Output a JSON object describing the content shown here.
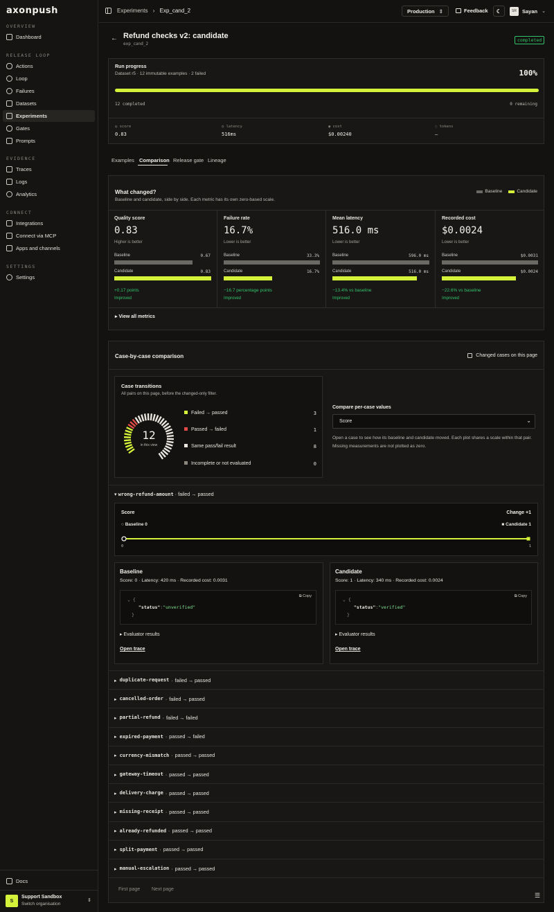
{
  "brand": "axonpush",
  "sidebar": {
    "sections": [
      {
        "title": "OVERVIEW",
        "items": [
          {
            "label": "Dashboard",
            "icon": "grid-icon"
          }
        ]
      },
      {
        "title": "RELEASE LOOP",
        "items": [
          {
            "label": "Actions",
            "icon": "shield-icon"
          },
          {
            "label": "Loop",
            "icon": "refresh-icon"
          },
          {
            "label": "Failures",
            "icon": "alert-icon"
          },
          {
            "label": "Datasets",
            "icon": "table-icon"
          },
          {
            "label": "Experiments",
            "icon": "flask-icon",
            "active": true
          },
          {
            "label": "Gates",
            "icon": "shield-check-icon"
          },
          {
            "label": "Prompts",
            "icon": "prompt-icon"
          }
        ]
      },
      {
        "title": "EVIDENCE",
        "items": [
          {
            "label": "Traces",
            "icon": "trace-icon"
          },
          {
            "label": "Logs",
            "icon": "log-icon"
          },
          {
            "label": "Analytics",
            "icon": "chart-icon"
          }
        ]
      },
      {
        "title": "CONNECT",
        "items": [
          {
            "label": "Integrations",
            "icon": "plug-icon"
          },
          {
            "label": "Connect via MCP",
            "icon": "link-icon"
          },
          {
            "label": "Apps and channels",
            "icon": "apps-icon"
          }
        ]
      },
      {
        "title": "SETTINGS",
        "items": [
          {
            "label": "Settings",
            "icon": "gear-icon"
          }
        ]
      }
    ],
    "docs": "Docs",
    "org": {
      "avatar": "S",
      "name": "Support Sandbox",
      "sub": "Switch organisation"
    }
  },
  "header": {
    "breadcrumb": [
      "Experiments",
      "Exp_cand_2"
    ],
    "env": "Production",
    "feedback": "Feedback",
    "user": {
      "initials": "SR",
      "name": "Sayan"
    }
  },
  "page": {
    "title": "Refund checks v2: candidate",
    "id": "exp_cand_2",
    "status": "completed"
  },
  "progress": {
    "title": "Run progress",
    "subtitle": "Dataset r5 · 12 immutable examples · 2 failed",
    "percent": "100%",
    "fraction": 1.0,
    "completed": "12 completed",
    "remaining": "0 remaining",
    "stats": [
      {
        "label": "score",
        "value": "0.83"
      },
      {
        "label": "latency",
        "value": "516ms"
      },
      {
        "label": "cost",
        "value": "$0.00240"
      },
      {
        "label": "tokens",
        "value": "—"
      }
    ]
  },
  "tabs": [
    "Examples",
    "Comparison",
    "Release gate",
    "Lineage"
  ],
  "active_tab": "Comparison",
  "changed": {
    "title": "What changed?",
    "subtitle": "Baseline and candidate, side by side. Each metric has its own zero-based scale.",
    "legend": {
      "baseline": "Baseline",
      "candidate": "Candidate"
    },
    "metrics": [
      {
        "title": "Quality score",
        "value": "0.83",
        "hint": "Higher is better",
        "baseline_label": "Baseline",
        "baseline": "0.67",
        "baseline_frac": 0.81,
        "candidate_label": "Candidate",
        "candidate": "0.83",
        "candidate_frac": 1.0,
        "delta": "+0.17 points",
        "verdict": "Improved"
      },
      {
        "title": "Failure rate",
        "value": "16.7%",
        "hint": "Lower is better",
        "baseline_label": "Baseline",
        "baseline": "33.3%",
        "baseline_frac": 1.0,
        "candidate_label": "Candidate",
        "candidate": "16.7%",
        "candidate_frac": 0.5,
        "delta": "−16.7 percentage points",
        "verdict": "Improved"
      },
      {
        "title": "Mean latency",
        "value": "516.0 ms",
        "hint": "Lower is better",
        "baseline_label": "Baseline",
        "baseline": "596.0 ms",
        "baseline_frac": 1.0,
        "candidate_label": "Candidate",
        "candidate": "516.0 ms",
        "candidate_frac": 0.87,
        "delta": "−13.4% vs baseline",
        "verdict": "Improved"
      },
      {
        "title": "Recorded cost",
        "value": "$0.0024",
        "hint": "Lower is better",
        "baseline_label": "Baseline",
        "baseline": "$0.0031",
        "baseline_frac": 1.0,
        "candidate_label": "Candidate",
        "candidate": "$0.0024",
        "candidate_frac": 0.77,
        "delta": "−22.6% vs baseline",
        "verdict": "Improved"
      }
    ],
    "view_all": "View all metrics"
  },
  "cases": {
    "title": "Case-by-case comparison",
    "filter_label": "Changed cases on this page",
    "transitions": {
      "title": "Case transitions",
      "subtitle": "All pairs on this page, before the changed-only filter.",
      "total": "12",
      "total_sub": "in this view",
      "rows": [
        {
          "label": "Failed → passed",
          "count": "3",
          "color": "#d4f23a"
        },
        {
          "label": "Passed → failed",
          "count": "1",
          "color": "#e04b45"
        },
        {
          "label": "Same pass/fail result",
          "count": "8",
          "color": "#e8e6df"
        },
        {
          "label": "Incomplete or not evaluated",
          "count": "0",
          "color": "#8a877f"
        }
      ]
    },
    "compare": {
      "label": "Compare per-case values",
      "selected": "Score",
      "help": "Open a case to see how its baseline and candidate moved. Each plot shares a scale within that pair. Missing measurements are not plotted as zero."
    },
    "expanded": {
      "name": "wrong-refund-amount",
      "transition": "failed → passed",
      "plot": {
        "title": "Score",
        "change": "Change +1",
        "baseline_label": "Baseline 0",
        "candidate_label": "Candidate 1",
        "min": "0",
        "max": "1",
        "baseline_value": 0,
        "candidate_value": 1
      },
      "baseline": {
        "title": "Baseline",
        "meta": "Score: 0 · Latency: 420 ms · Recorded cost: 0.0031",
        "copy": "Copy",
        "key": "\"status\"",
        "value": "\"unverified\"",
        "evaluator": "Evaluator results",
        "trace": "Open trace"
      },
      "candidate": {
        "title": "Candidate",
        "meta": "Score: 1 · Latency: 340 ms · Recorded cost: 0.0024",
        "copy": "Copy",
        "key": "\"status\"",
        "value": "\"verified\"",
        "evaluator": "Evaluator results",
        "trace": "Open trace"
      }
    },
    "rows": [
      {
        "name": "duplicate-request",
        "transition": "failed → passed"
      },
      {
        "name": "cancelled-order",
        "transition": "failed → passed"
      },
      {
        "name": "partial-refund",
        "transition": "failed → failed"
      },
      {
        "name": "expired-payment",
        "transition": "passed → failed"
      },
      {
        "name": "currency-mismatch",
        "transition": "passed → passed"
      },
      {
        "name": "gateway-timeout",
        "transition": "passed → passed"
      },
      {
        "name": "delivery-charge",
        "transition": "passed → passed"
      },
      {
        "name": "missing-receipt",
        "transition": "passed → passed"
      },
      {
        "name": "already-refunded",
        "transition": "passed → passed"
      },
      {
        "name": "split-payment",
        "transition": "passed → passed"
      },
      {
        "name": "manual-escalation",
        "transition": "passed → passed"
      }
    ],
    "pagination": {
      "first": "First page",
      "next": "Next page"
    }
  }
}
